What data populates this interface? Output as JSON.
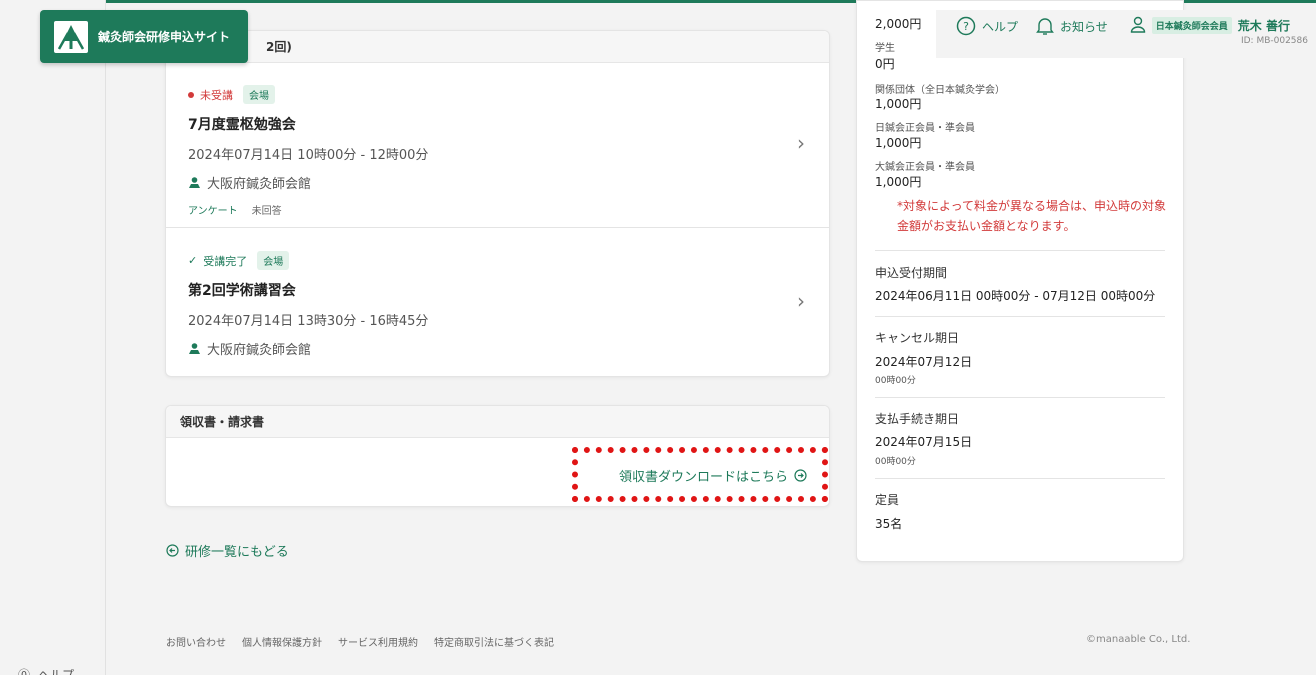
{
  "brand": {
    "name": "鍼灸師会研修申込サイト"
  },
  "header": {
    "help": "ヘルプ",
    "notifications": "お知らせ",
    "member_badge": "日本鍼灸師会会員",
    "user_name": "荒木 善行",
    "user_id": "ID: MB-002586"
  },
  "sessions_card": {
    "title_partial": "2回)",
    "sessions": [
      {
        "status": "未受講",
        "tag": "会場",
        "title": "7月度霊枢勉強会",
        "date": "2024年07月14日 10時00分 - 12時00分",
        "venue": "大阪府鍼灸師会館",
        "survey_label": "アンケート",
        "survey_status": "未回答"
      },
      {
        "status": "受講完了",
        "tag": "会場",
        "title": "第2回学術講習会",
        "date": "2024年07月14日 13時30分 - 16時45分",
        "venue": "大阪府鍼灸師会館"
      }
    ]
  },
  "receipt_card": {
    "title": "領収書・請求書",
    "download_link": "領収書ダウンロードはこちら"
  },
  "back_link": "研修一覧にもどる",
  "footer": {
    "links": [
      "お問い合わせ",
      "個人情報保護方針",
      "サービス利用規約",
      "特定商取引法に基づく表記"
    ],
    "copyright": "©manaable Co., Ltd."
  },
  "sidebar": {
    "fees": [
      {
        "label": "",
        "value": "2,000円"
      },
      {
        "label": "学生",
        "value": "0円"
      },
      {
        "label": "関係団体（全日本鍼灸学会）",
        "value": "1,000円"
      },
      {
        "label": "日鍼会正会員・準会員",
        "value": "1,000円"
      },
      {
        "label": "大鍼会正会員・準会員",
        "value": "1,000円"
      }
    ],
    "fee_note": "*対象によって料金が異なる場合は、申込時の対象金額がお支払い金額となります。",
    "application_period_title": "申込受付期間",
    "application_period": "2024年06月11日 00時00分 - 07月12日 00時00分",
    "cancel_title": "キャンセル期日",
    "cancel_date": "2024年07月12日",
    "cancel_time": "00時00分",
    "payment_title": "支払手続き期日",
    "payment_date": "2024年07月15日",
    "payment_time": "00時00分",
    "capacity_title": "定員",
    "capacity": "35名"
  },
  "left_rail": {
    "help": "ヘルプ"
  },
  "colors": {
    "brand": "#1e7a5a",
    "alert": "#d23a3a",
    "highlight": "#e01515"
  }
}
